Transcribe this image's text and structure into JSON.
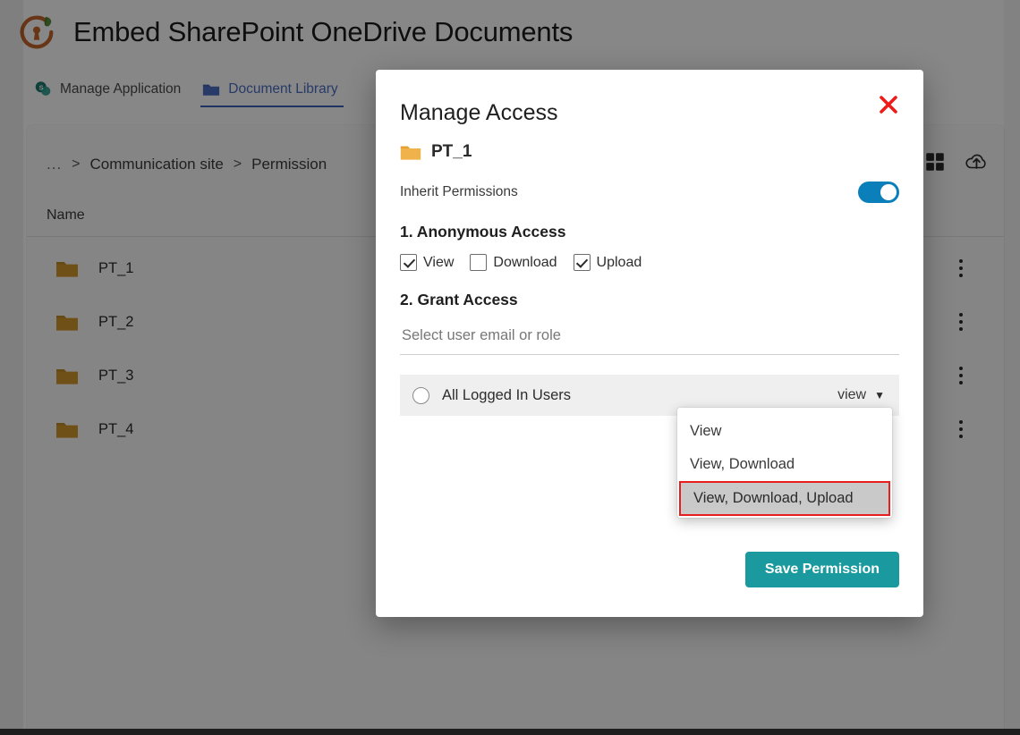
{
  "app": {
    "title": "Embed SharePoint OneDrive Documents",
    "logo_icon": "shield-keyhole-leaf-logo"
  },
  "tabs": [
    {
      "label": "Manage Application",
      "icon": "sharepoint-icon",
      "active": false
    },
    {
      "label": "Document Library",
      "icon": "folder-icon",
      "active": true
    }
  ],
  "breadcrumb": {
    "dots": "...",
    "separator": ">",
    "items": [
      "Communication site",
      "Permission"
    ]
  },
  "toolbar": {
    "grid_view_icon": "grid-view-icon",
    "upload_icon": "cloud-upload-icon"
  },
  "table": {
    "column_header": "Name",
    "rows": [
      {
        "name": "PT_1",
        "icon": "folder-icon",
        "menu_icon": "more-vertical-icon"
      },
      {
        "name": "PT_2",
        "icon": "folder-icon",
        "menu_icon": "more-vertical-icon"
      },
      {
        "name": "PT_3",
        "icon": "folder-icon",
        "menu_icon": "more-vertical-icon"
      },
      {
        "name": "PT_4",
        "icon": "folder-icon",
        "menu_icon": "more-vertical-icon"
      }
    ]
  },
  "modal": {
    "title": "Manage Access",
    "close_icon": "close-x-icon",
    "subject": {
      "name": "PT_1",
      "icon": "folder-icon"
    },
    "inherit": {
      "label": "Inherit Permissions",
      "enabled": true
    },
    "anonymous": {
      "heading": "1. Anonymous Access",
      "options": [
        {
          "label": "View",
          "checked": true
        },
        {
          "label": "Download",
          "checked": false
        },
        {
          "label": "Upload",
          "checked": true
        }
      ]
    },
    "grant": {
      "heading": "2. Grant Access",
      "search_value": "",
      "search_placeholder": "Select user email or role",
      "grantee": {
        "name": "All Logged In Users",
        "selected": false,
        "permission_value": "view",
        "caret_icon": "chevron-down-icon"
      },
      "dropdown": {
        "options": [
          "View",
          "View, Download",
          "View, Download, Upload"
        ],
        "highlighted_index": 2,
        "highlight_border_color": "#e81d1d",
        "highlight_fill_color": "#c9c9c9"
      }
    },
    "save_label": "Save Permission"
  },
  "colors": {
    "toggle_on": "#0b7fba",
    "save_button": "#1a9a9e",
    "tab_active": "#4a6fc4",
    "close_red": "#ee1b1b",
    "folder_amber": "#d19a2e"
  }
}
